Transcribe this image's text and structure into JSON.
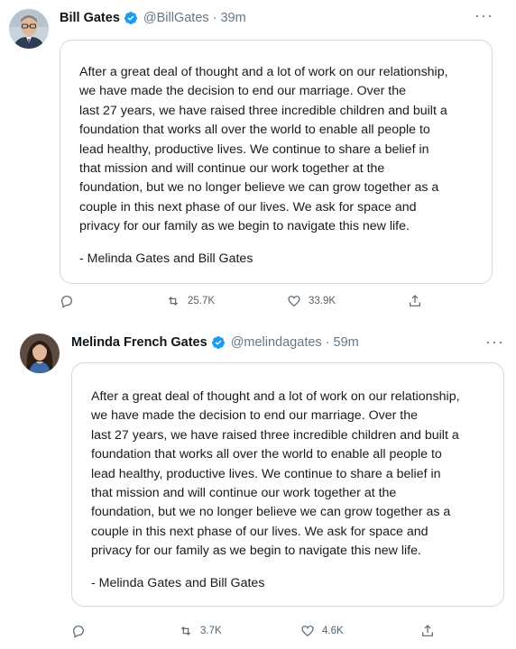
{
  "tweets": [
    {
      "author_name": "Bill Gates",
      "handle": "@BillGates",
      "separator": "·",
      "time": "39m",
      "more_label": "···",
      "body": "After a great deal of thought and a lot of work on our relationship,\nwe have made the decision to end our marriage. Over the\nlast 27 years, we have raised three incredible children and built a\nfoundation that works all over the world to enable all people to\nlead healthy, productive lives. We continue to share a belief in\nthat mission and will continue our work together at the\nfoundation, but we no longer believe we can grow together as a\ncouple in this next phase of our lives. We ask for space and\nprivacy for our family as we begin to navigate this new life.",
      "signature": "- Melinda Gates and Bill Gates",
      "retweets": "25.7K",
      "likes": "33.9K"
    },
    {
      "author_name": "Melinda French Gates",
      "handle": "@melindagates",
      "separator": "·",
      "time": "59m",
      "more_label": "···",
      "body": "After a great deal of thought and a lot of work on our relationship,\nwe have made the decision to end our marriage. Over the\nlast 27 years, we have raised three incredible children and built a\nfoundation that works all over the world to enable all people to\nlead healthy, productive lives. We continue to share a belief in\nthat mission and will continue our work together at the\nfoundation, but we no longer believe we can grow together as a\ncouple in this next phase of our lives. We ask for space and\nprivacy for our family as we begin to navigate this new life.",
      "signature": "- Melinda Gates and Bill Gates",
      "retweets": "3.7K",
      "likes": "4.6K"
    }
  ],
  "icons": {
    "verified": "verified-badge-icon",
    "reply": "reply-icon",
    "retweet": "retweet-icon",
    "like": "heart-icon",
    "share": "share-icon"
  },
  "colors": {
    "verified_blue": "#1d9bf0",
    "muted_text": "#657786",
    "card_border": "#cfd9de"
  }
}
